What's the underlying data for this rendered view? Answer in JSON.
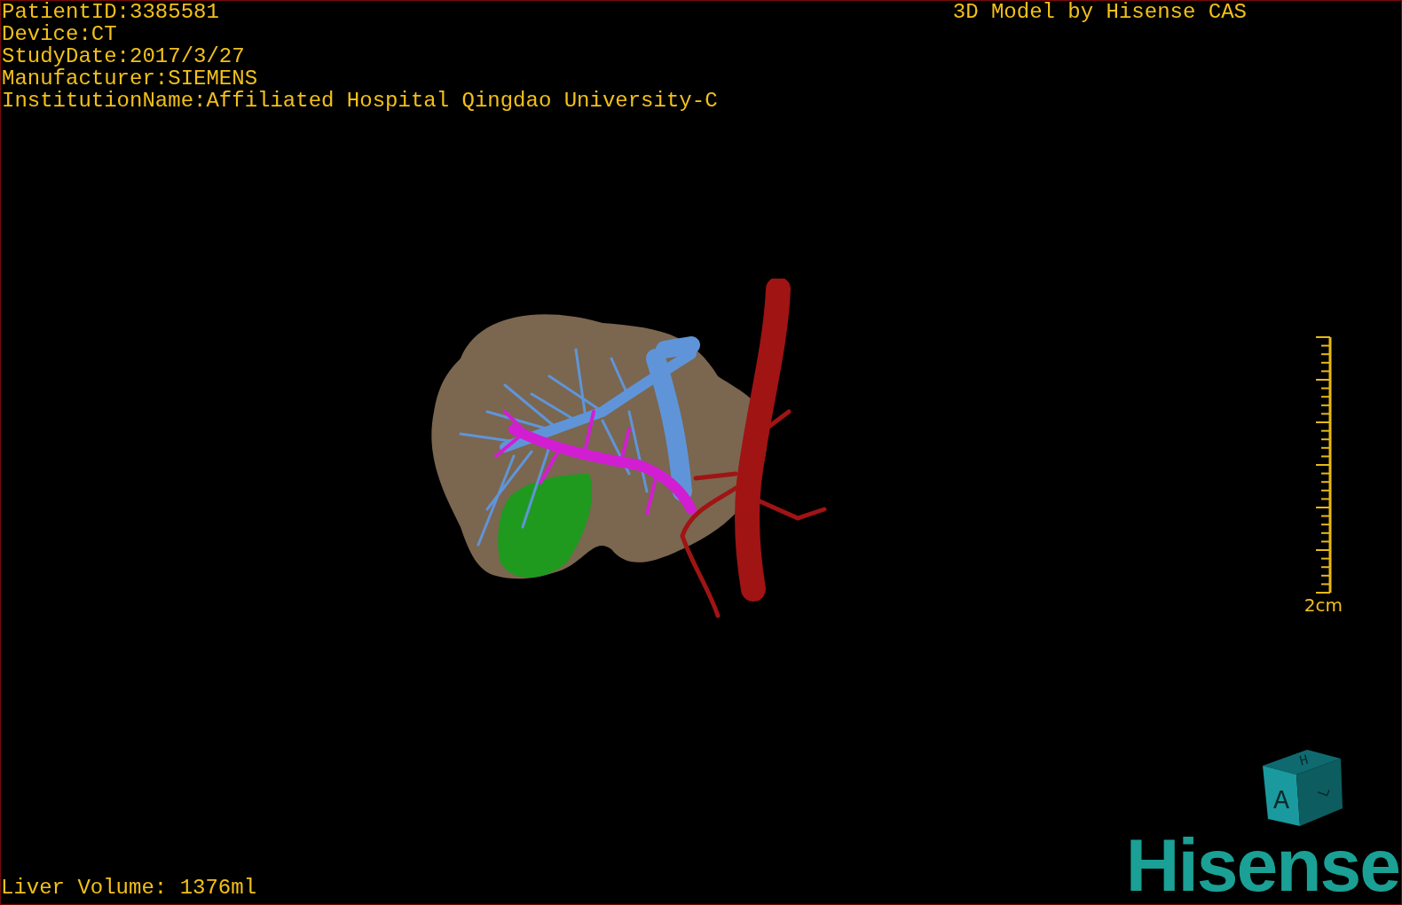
{
  "info_lines": [
    "PatientID:3385581",
    "Device:CT",
    "StudyDate:2017/3/27",
    "Manufacturer:SIEMENS",
    "InstitutionName:Affiliated Hospital Qingdao University-C"
  ],
  "title": "3D Model by Hisense CAS",
  "scale_bar": {
    "label": "2cm"
  },
  "liver_volume": "Liver Volume: 1376ml",
  "orientation_cube": {
    "top": "H",
    "front": "A",
    "side": "L"
  },
  "logo": "Hisense"
}
